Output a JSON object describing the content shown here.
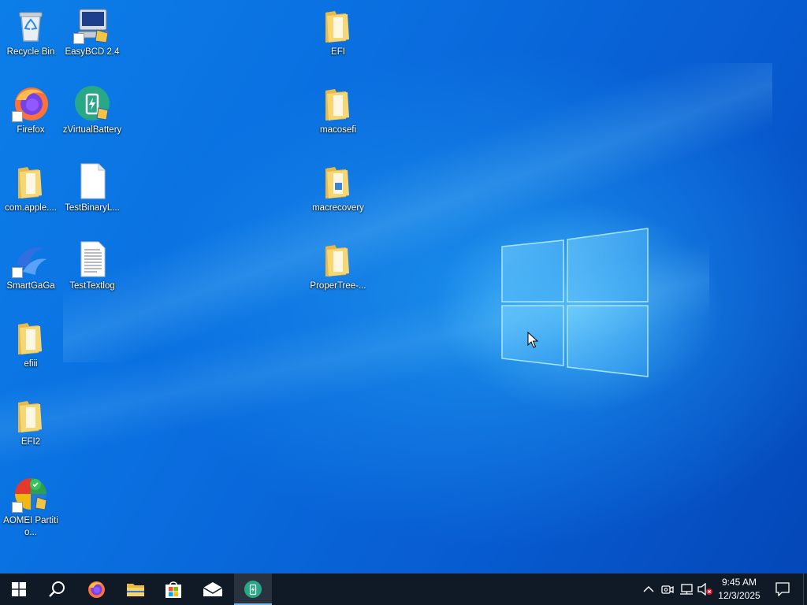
{
  "desktop": {
    "icons": [
      {
        "label": "Recycle Bin",
        "icon": "recycle-bin-icon"
      },
      {
        "label": "EasyBCD 2.4",
        "icon": "easybcd-icon",
        "shortcut": true
      },
      {
        "label": "EFI",
        "icon": "folder-icon"
      },
      {
        "label": "Firefox",
        "icon": "firefox-icon",
        "shortcut": true
      },
      {
        "label": "zVirtualBattery",
        "icon": "battery-app-icon"
      },
      {
        "label": "macosefi",
        "icon": "folder-icon"
      },
      {
        "label": "com.apple....",
        "icon": "folder-icon"
      },
      {
        "label": "TestBinaryL...",
        "icon": "blank-file-icon"
      },
      {
        "label": "macrecovery",
        "icon": "folder-icon"
      },
      {
        "label": "SmartGaGa",
        "icon": "smartgaga-icon",
        "shortcut": true
      },
      {
        "label": "TestTextlog",
        "icon": "text-file-icon"
      },
      {
        "label": "ProperTree-...",
        "icon": "folder-icon"
      },
      {
        "label": "efiii",
        "icon": "folder-icon"
      },
      {
        "label": "EFI2",
        "icon": "folder-icon"
      },
      {
        "label": "AOMEI Partitio...",
        "icon": "aomei-icon",
        "shortcut": true
      }
    ]
  },
  "taskbar": {
    "buttons": [
      {
        "name": "start",
        "icon": "windows-start-icon"
      },
      {
        "name": "search",
        "icon": "search-icon"
      },
      {
        "name": "firefox",
        "icon": "firefox-icon"
      },
      {
        "name": "file-explorer",
        "icon": "folder-icon"
      },
      {
        "name": "microsoft-store",
        "icon": "store-icon"
      },
      {
        "name": "mail",
        "icon": "mail-icon"
      },
      {
        "name": "zvirtualbattery",
        "icon": "battery-app-icon",
        "active": true
      }
    ],
    "tray": {
      "icons": [
        "chevron-up-icon",
        "meet-now-icon",
        "network-icon",
        "volume-muted-icon"
      ],
      "time": "9:45 AM",
      "date": "12/3/2025",
      "notification_icon": "notification-icon"
    },
    "colors": {
      "taskbar_bg": "#101a26",
      "active_indicator": "#76b9ed"
    }
  }
}
